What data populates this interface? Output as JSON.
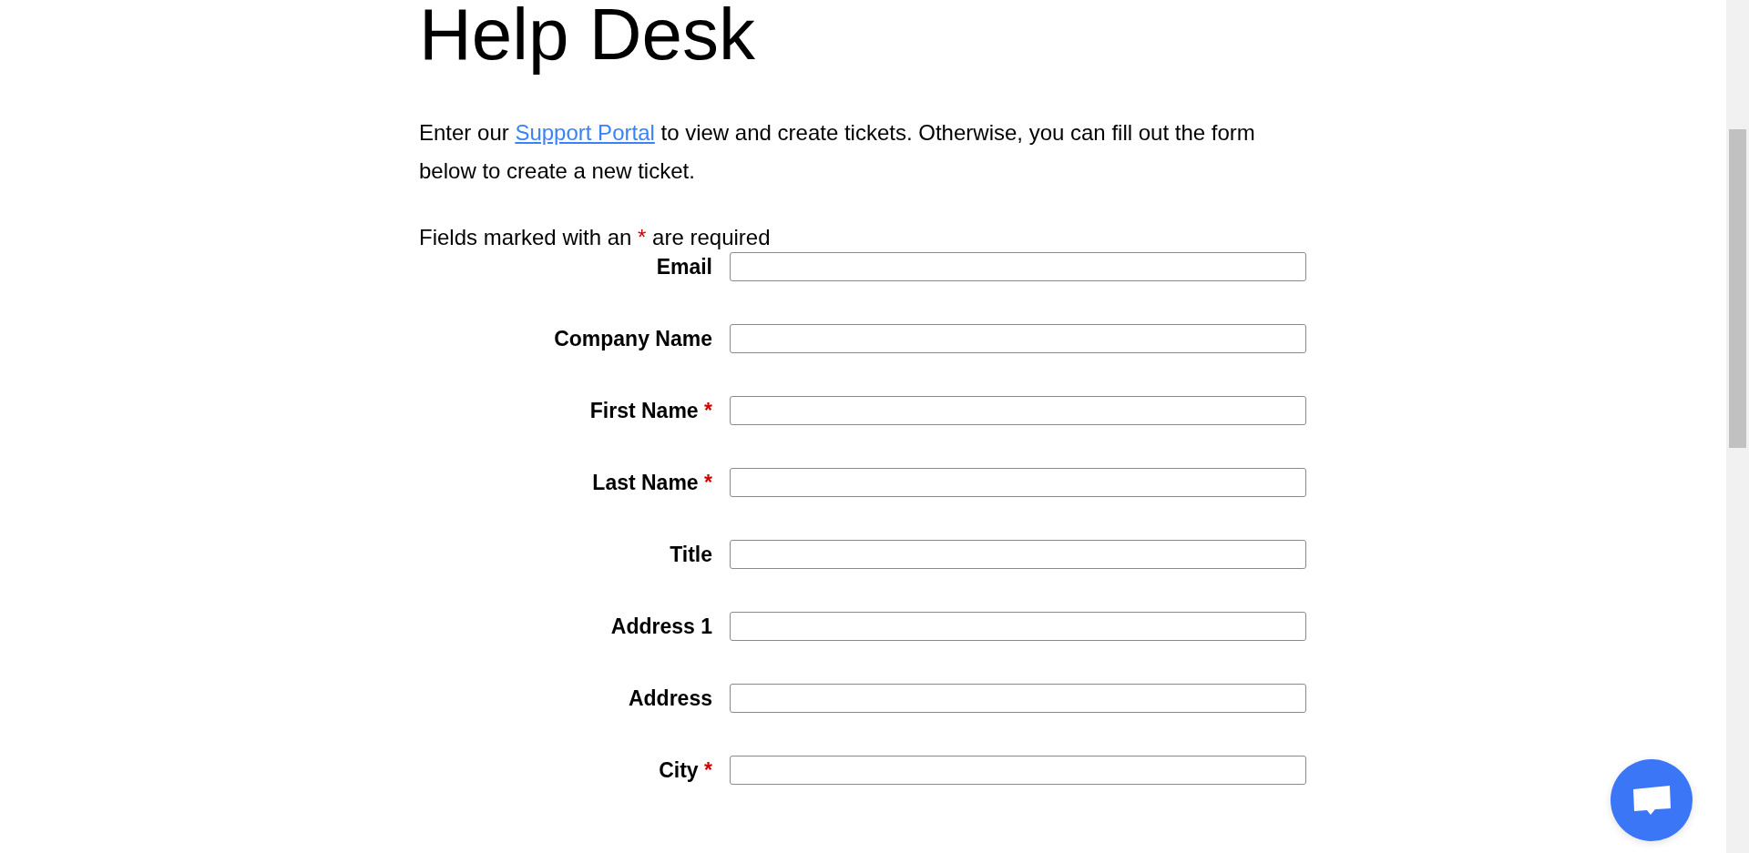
{
  "title": "Help Desk",
  "intro": {
    "before": "Enter our ",
    "link": "Support Portal",
    "after": " to view and create tickets. Otherwise, you can fill out the form below to create a new ticket."
  },
  "required_note": {
    "before": "Fields marked with an ",
    "mark": "*",
    "after": " are required"
  },
  "fields": [
    {
      "label": "Email"
    },
    {
      "label": "Company Name"
    },
    {
      "label": "First Name",
      "required_mark": "*"
    },
    {
      "label": "Last Name",
      "required_mark": "*"
    },
    {
      "label": "Title"
    },
    {
      "label": "Address 1"
    },
    {
      "label": "Address"
    },
    {
      "label": "City",
      "required_mark": "*"
    }
  ]
}
